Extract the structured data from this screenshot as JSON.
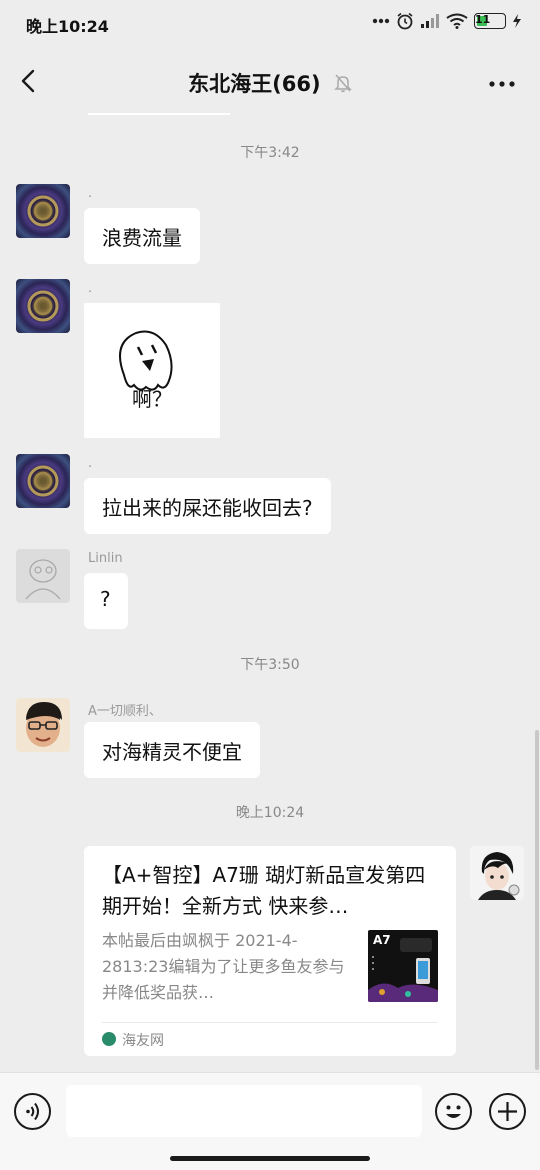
{
  "status_bar": {
    "time": "晚上10:24",
    "battery": "11"
  },
  "nav": {
    "title": "东北海王(66)"
  },
  "timestamps": [
    "下午3:42",
    "下午3:50",
    "晚上10:24"
  ],
  "messages": [
    {
      "sender": ".",
      "text": "浪费流量"
    },
    {
      "sender": ".",
      "sticker_text": "啊？"
    },
    {
      "sender": ".",
      "text": "拉出来的屎还能收回去?"
    },
    {
      "sender": "Linlin",
      "text": "?"
    },
    {
      "sender": "A一切顺利、",
      "text": "对海精灵不便宜"
    }
  ],
  "card": {
    "title": "【A+智控】A7珊 瑚灯新品宣发第四期开始！全新方式  快来参…",
    "description": "本帖最后由飒枫于 2021-4-2813:23编辑为了让更多鱼友参与并降低奖品获…",
    "thumb_label": "A7",
    "source": "海友网"
  },
  "colors": {
    "background": "#ededed",
    "bubble": "#ffffff",
    "source_icon": "#2a8b6a"
  }
}
